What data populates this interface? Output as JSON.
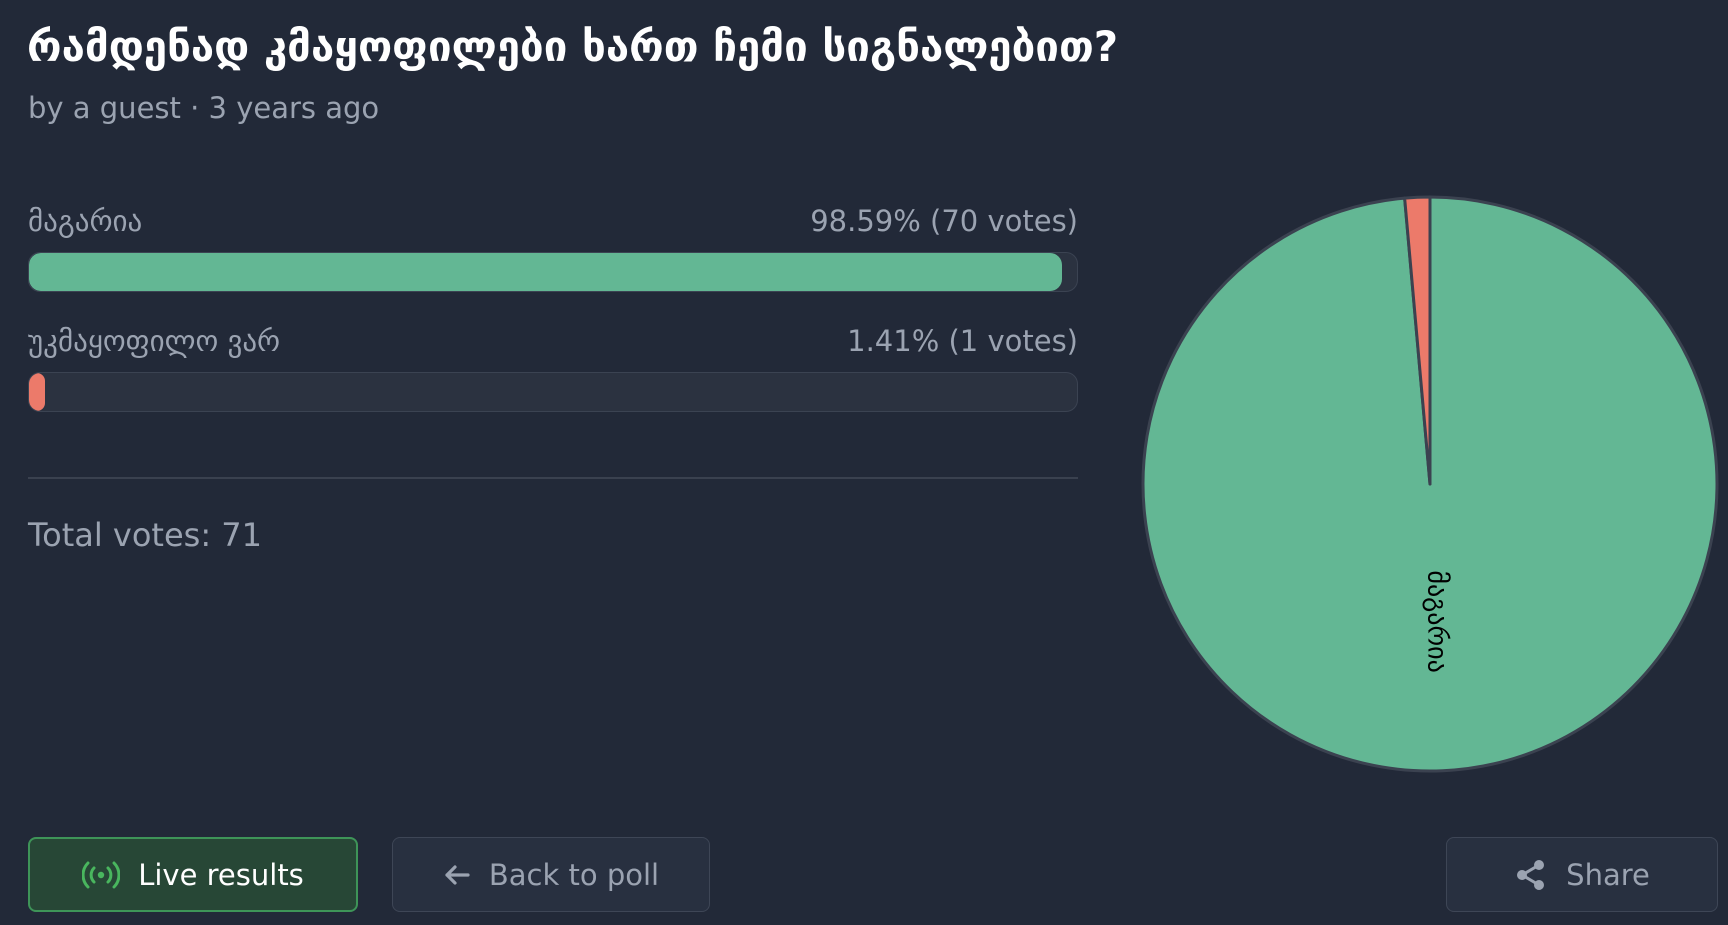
{
  "poll": {
    "title": "რამდენად კმაყოფილები ხართ ჩემი სიგნალებით?",
    "byline": "by a guest · 3 years ago",
    "total_label": "Total votes: 71"
  },
  "options": [
    {
      "label": "მაგარია",
      "stats": "98.59% (70 votes)",
      "color": "#63b794"
    },
    {
      "label": "უკმაყოფილო ვარ",
      "stats": "1.41% (1 votes)",
      "color": "#ec7a6a"
    }
  ],
  "chart_data": {
    "type": "pie",
    "labels": [
      "მაგარია",
      "უკმაყოფილო ვარ"
    ],
    "values": [
      70,
      1
    ],
    "colors": [
      "#63b794",
      "#ec7a6a"
    ]
  },
  "buttons": {
    "live_label": "Live results",
    "back_label": "Back to poll",
    "share_label": "Share"
  },
  "icons": {
    "live": "broadcast-icon",
    "back": "arrow-left-icon",
    "share": "share-icon"
  },
  "colors": {
    "background": "#222938",
    "text_muted": "#9ba3b1",
    "live_accent": "#49b65e"
  }
}
